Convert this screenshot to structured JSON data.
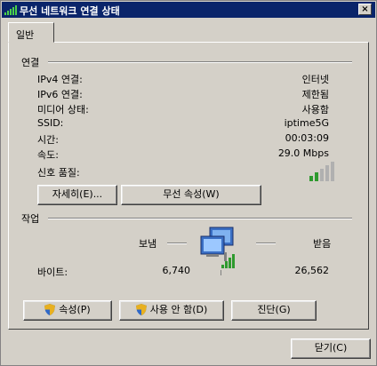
{
  "window": {
    "title": "무선 네트워크 연결 상태",
    "close_glyph": "×"
  },
  "tabs": [
    {
      "label": "일반"
    }
  ],
  "connection": {
    "heading": "연결",
    "rows": [
      {
        "label": "IPv4 연결:",
        "value": "인터넷"
      },
      {
        "label": "IPv6 연결:",
        "value": "제한됨"
      },
      {
        "label": "미디어 상태:",
        "value": "사용함"
      },
      {
        "label": "SSID:",
        "value": "iptime5G"
      },
      {
        "label": "시간:",
        "value": "00:03:09"
      },
      {
        "label": "속도:",
        "value": "29.0 Mbps"
      }
    ],
    "signal_label": "신호 품질:",
    "signal_bars_filled": 2,
    "signal_bars_total": 5
  },
  "buttons": {
    "details": "자세히(E)...",
    "wireless_properties": "무선 속성(W)",
    "properties": "속성(P)",
    "disable": "사용 안 함(D)",
    "diagnose": "진단(G)",
    "close": "닫기(C)"
  },
  "activity": {
    "heading": "작업",
    "sent_label": "보냄",
    "received_label": "받음",
    "bytes_label": "바이트:",
    "bytes_sent": "6,740",
    "bytes_received": "26,562"
  },
  "icons": {
    "title_icon": "wireless-signal-icon",
    "network_icon": "network-computers-icon",
    "shield_icon": "uac-shield-icon"
  },
  "colors": {
    "title_bar": "#0a246a",
    "window_bg": "#d4d0c8",
    "signal_green": "#2e9a2e"
  }
}
